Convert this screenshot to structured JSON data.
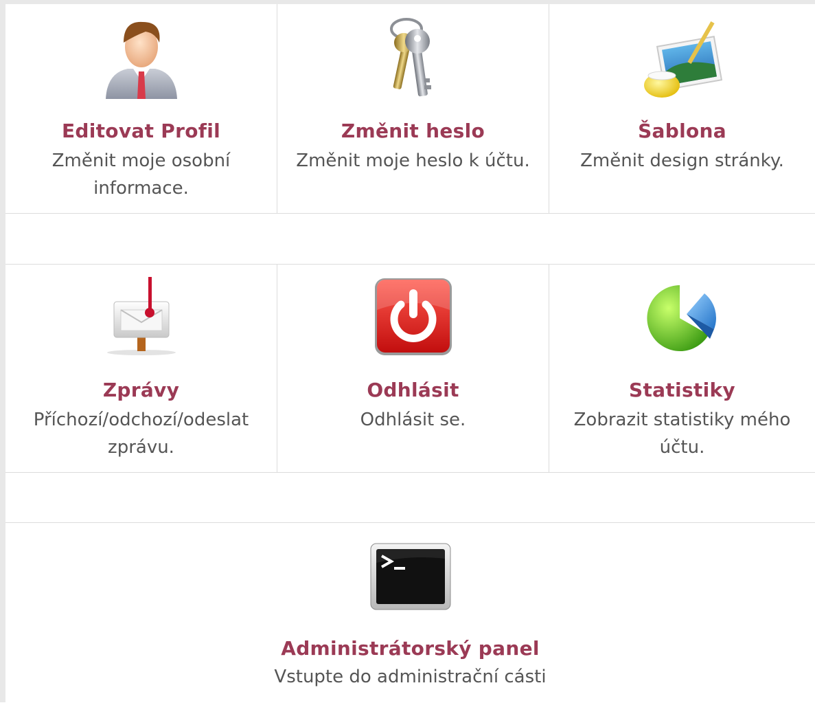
{
  "tiles": [
    {
      "title": "Editovat Profil",
      "description": "Změnit moje osobní informace.",
      "icon": "user-profile-icon"
    },
    {
      "title": "Změnit heslo",
      "description": "Změnit moje heslo k účtu.",
      "icon": "keys-icon"
    },
    {
      "title": "Šablona",
      "description": "Změnit design stránky.",
      "icon": "template-paint-icon"
    },
    {
      "title": "Zprávy",
      "description": "Příchozí/odchozí/odeslat zprávu.",
      "icon": "mailbox-icon"
    },
    {
      "title": "Odhlásit",
      "description": "Odhlásit se.",
      "icon": "power-icon"
    },
    {
      "title": "Statistiky",
      "description": "Zobrazit statistiky mého účtu.",
      "icon": "pie-chart-icon"
    },
    {
      "title": "Administrátorský panel",
      "description": "Vstupte do administrační cásti",
      "icon": "terminal-icon"
    }
  ],
  "colors": {
    "title": "#9b3a55",
    "description": "#555555",
    "divider": "#dcdcdc"
  }
}
